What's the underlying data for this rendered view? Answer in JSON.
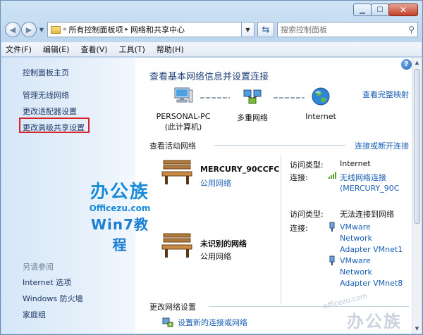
{
  "window": {
    "caption_buttons": [
      "minimize-icon",
      "maximize-icon",
      "close-icon"
    ]
  },
  "address": {
    "prefix": "«",
    "crumbs": [
      "所有控制面板项",
      "网络和共享中心"
    ],
    "separator": "▸"
  },
  "search": {
    "placeholder": "搜索控制面板"
  },
  "menu": [
    "文件(F)",
    "编辑(E)",
    "查看(V)",
    "工具(T)",
    "帮助(H)"
  ],
  "sidebar": {
    "home": "控制面板主页",
    "links": [
      "管理无线网络",
      "更改适配器设置",
      "更改高级共享设置"
    ],
    "see_also_title": "另请参阅",
    "see_also": [
      "Internet 选项",
      "Windows 防火墙",
      "家庭组"
    ],
    "highlight_color": "#d8222a"
  },
  "logo": {
    "line1": "办公族",
    "line2": "Officezu.com",
    "line3": "Win7教程"
  },
  "main": {
    "title": "查看基本网络信息并设置连接",
    "full_map_link": "查看完整映射",
    "nodes": [
      {
        "label": "PERSONAL-PC",
        "sublabel": "(此计算机)"
      },
      {
        "label": "多重网络",
        "sublabel": ""
      },
      {
        "label": "Internet",
        "sublabel": ""
      }
    ],
    "active_section": "查看活动网络",
    "connect_link": "连接或断开连接",
    "networks": [
      {
        "name": "MERCURY_90CCFC",
        "type": "公用网络",
        "access_label": "访问类型:",
        "access_value": "Internet",
        "conn_label": "连接:",
        "connections": [
          "无线网络连接",
          "(MERCURY_90C"
        ]
      },
      {
        "name": "未识别的网络",
        "type": "公用网络",
        "access_label": "访问类型:",
        "access_value": "无法连接到网络",
        "conn_label": "连接:",
        "connections": [
          "VMware",
          "Network",
          "Adapter VMnet1",
          "VMware",
          "Network",
          "Adapter VMnet8"
        ]
      }
    ],
    "change_section": "更改网络设置",
    "setup_link": "设置新的连接或网络"
  },
  "watermark": {
    "url": "officezu.com",
    "logo": "办公族"
  },
  "colors": {
    "accent": "#1a5fb4",
    "title": "#1e3f78"
  }
}
